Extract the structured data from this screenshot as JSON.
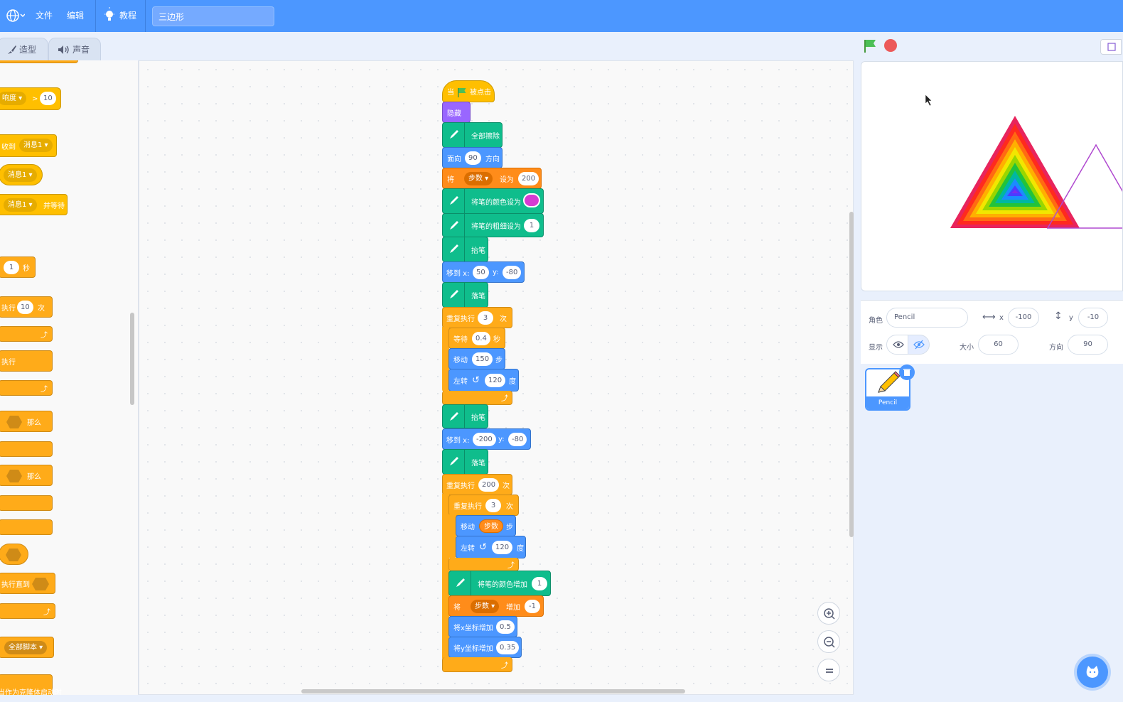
{
  "menubar": {
    "file": "文件",
    "edit": "编辑",
    "tutorials": "教程",
    "project_title": "三边形"
  },
  "tabs": {
    "costumes": "造型",
    "sounds": "声音"
  },
  "palette": {
    "loudness_label": "响度",
    "gt": ">",
    "loudness_value": "10",
    "when_receive": "收到",
    "message1": "消息1",
    "broadcast_and_wait": "并等待",
    "wait_value": "1",
    "wait_unit": "秒",
    "repeat": "执行",
    "repeat_value": "10",
    "repeat_unit": "次",
    "forever": "执行",
    "then": "那么",
    "repeat_until": "执行直到",
    "stop_all": "全部脚本",
    "clone_start": "当作为克隆体启动时"
  },
  "script": {
    "when_flag": "当",
    "when_flag_suffix": "被点击",
    "hide": "隐藏",
    "erase_all": "全部擦除",
    "point_dir": "面向",
    "point_dir_value": "90",
    "point_dir_suffix": "方向",
    "set_var": "将",
    "var_name": "步数",
    "set_to": "设为",
    "set_value": "200",
    "set_pen_color": "将笔的颜色设为",
    "pen_color_swatch": "#d53bd2",
    "set_pen_size": "将笔的粗细设为",
    "pen_size_value": "1",
    "pen_up": "抬笔",
    "goto": "移到 x:",
    "goto_y": "y:",
    "goto1_x": "50",
    "goto1_y": "-80",
    "pen_down": "落笔",
    "repeat": "重复执行",
    "repeat1_times": "3",
    "repeat_unit": "次",
    "wait": "等待",
    "wait_value": "0.4",
    "wait_unit": "秒",
    "move": "移动",
    "move1_value": "150",
    "move_unit": "步",
    "turn_left": "左转",
    "turn_value": "120",
    "turn_unit": "度",
    "pen_up2": "抬笔",
    "goto2_x": "-200",
    "goto2_y": "-80",
    "pen_down2": "落笔",
    "repeat2_times": "200",
    "repeat3_times": "3",
    "change_pen_color": "将笔的颜色增加",
    "change_pen_value": "1",
    "change_var": "增加",
    "change_var_value": "-1",
    "change_x": "将x坐标增加",
    "change_x_value": "0.5",
    "change_y": "将y坐标增加",
    "change_y_value": "0.35"
  },
  "sprite_info": {
    "sprite_label": "角色",
    "sprite_name": "Pencil",
    "x_label": "x",
    "x_value": "-100",
    "y_label": "y",
    "y_value": "-10",
    "show_label": "显示",
    "size_label": "大小",
    "size_value": "60",
    "direction_label": "方向",
    "direction_value": "90"
  },
  "sprites": [
    {
      "name": "Pencil"
    }
  ],
  "colors": {
    "menu_blue": "#4c97ff",
    "events": "#ffbf00",
    "control": "#ffab19",
    "motion": "#4c97ff",
    "looks": "#9966ff",
    "pen": "#0fbd8c",
    "variables": "#ff8c1a",
    "green_flag": "#4cbf56",
    "stop": "#ec5959"
  }
}
